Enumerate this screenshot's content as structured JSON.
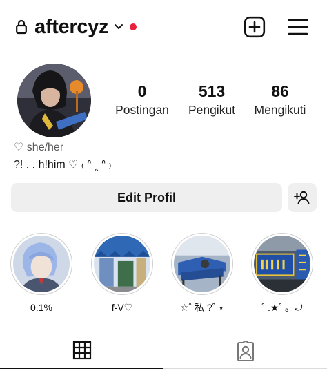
{
  "header": {
    "username": "aftercyz",
    "lock_icon": "lock-icon",
    "switch_account_icon": "chevron-down-icon",
    "notification_dot_color": "#e8223c",
    "create_icon": "plus-square-icon",
    "menu_icon": "hamburger-menu-icon"
  },
  "profile": {
    "avatar": "profile-photo",
    "stats": [
      {
        "value": "0",
        "label": "Postingan"
      },
      {
        "value": "513",
        "label": "Pengikut"
      },
      {
        "value": "86",
        "label": "Mengikuti"
      }
    ],
    "pronouns": "♡ she/her",
    "bio": "?! .  .   h!him ♡ ₍ ᐢ ‸ ᐢ ₎"
  },
  "actions": {
    "edit_profile_label": "Edit Profil",
    "discover_people_icon": "add-person-icon"
  },
  "highlights": [
    {
      "label": "0.1%"
    },
    {
      "label": "f-V♡"
    },
    {
      "label": "☆˚ 私 ?˚ ⋆"
    },
    {
      "label": "˚ .★˚ 。⤾"
    }
  ],
  "tabs": [
    {
      "icon": "grid-icon",
      "active": true
    },
    {
      "icon": "tagged-person-icon",
      "active": false
    }
  ]
}
